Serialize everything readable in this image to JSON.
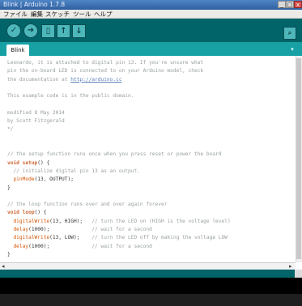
{
  "window": {
    "title": "Blink | Arduino 1.7.8",
    "minimize": "_",
    "maximize": "□",
    "close": "x"
  },
  "menu": [
    "ファイル",
    "編集",
    "スケッチ",
    "ツール",
    "ヘルプ"
  ],
  "toolbar": {
    "verify_icon": "check-icon",
    "upload_icon": "arrow-right-icon",
    "new_icon": "new-file-icon",
    "open_icon": "open-icon",
    "save_icon": "save-icon",
    "serial_icon": "serial-monitor-icon"
  },
  "tabs": [
    {
      "label": "Blink"
    }
  ],
  "tab_menu_icon": "chevron-down-icon",
  "editor": {
    "lines": [
      [
        {
          "t": "Leonardo, it is attached to digital pin 13. If you're unsure what",
          "c": "cmt"
        }
      ],
      [
        {
          "t": "pin the on-board LED is connected to on your Arduino model, check",
          "c": "cmt"
        }
      ],
      [
        {
          "t": "the documentation at ",
          "c": "cmt"
        },
        {
          "t": "http://arduino.cc",
          "c": "link"
        }
      ],
      [
        {
          "t": "",
          "c": "cmt"
        }
      ],
      [
        {
          "t": "This example code is in the public domain.",
          "c": "cmt"
        }
      ],
      [
        {
          "t": "",
          "c": "cmt"
        }
      ],
      [
        {
          "t": "modified 8 May 2014",
          "c": "cmt"
        }
      ],
      [
        {
          "t": "by Scott Fitzgerald",
          "c": "cmt"
        }
      ],
      [
        {
          "t": "*/",
          "c": "cmt"
        }
      ],
      [
        {
          "t": "",
          "c": "plain"
        }
      ],
      [
        {
          "t": "",
          "c": "plain"
        }
      ],
      [
        {
          "t": "// the setup function runs once when you press reset or power the board",
          "c": "cmt"
        }
      ],
      [
        {
          "t": "void ",
          "c": "kw"
        },
        {
          "t": "setup",
          "c": "kw"
        },
        {
          "t": "() {",
          "c": "plain"
        }
      ],
      [
        {
          "t": "  // initialize digital pin 13 as an output.",
          "c": "cmt"
        }
      ],
      [
        {
          "t": "  ",
          "c": "plain"
        },
        {
          "t": "pinMode",
          "c": "fn"
        },
        {
          "t": "(13, OUTPUT);",
          "c": "plain"
        }
      ],
      [
        {
          "t": "}",
          "c": "plain"
        }
      ],
      [
        {
          "t": "",
          "c": "plain"
        }
      ],
      [
        {
          "t": "// the loop function runs over and over again forever",
          "c": "cmt"
        }
      ],
      [
        {
          "t": "void ",
          "c": "kw"
        },
        {
          "t": "loop",
          "c": "kw"
        },
        {
          "t": "() {",
          "c": "plain"
        }
      ],
      [
        {
          "t": "  ",
          "c": "plain"
        },
        {
          "t": "digitalWrite",
          "c": "fn"
        },
        {
          "t": "(13, HIGH);   ",
          "c": "plain"
        },
        {
          "t": "// turn the LED on (HIGH is the voltage level)",
          "c": "cmt"
        }
      ],
      [
        {
          "t": "  ",
          "c": "plain"
        },
        {
          "t": "delay",
          "c": "fn"
        },
        {
          "t": "(1000);              ",
          "c": "plain"
        },
        {
          "t": "// wait for a second",
          "c": "cmt"
        }
      ],
      [
        {
          "t": "  ",
          "c": "plain"
        },
        {
          "t": "digitalWrite",
          "c": "fn"
        },
        {
          "t": "(13, LOW);    ",
          "c": "plain"
        },
        {
          "t": "// turn the LED off by making the voltage LOW",
          "c": "cmt"
        }
      ],
      [
        {
          "t": "  ",
          "c": "plain"
        },
        {
          "t": "delay",
          "c": "fn"
        },
        {
          "t": "(1000);              ",
          "c": "plain"
        },
        {
          "t": "// wait for a second",
          "c": "cmt"
        }
      ],
      [
        {
          "t": "}",
          "c": "plain"
        }
      ]
    ]
  },
  "hscroll": {
    "left": "◂",
    "right": "▸"
  },
  "colors": {
    "toolbar": "#006468",
    "tabstrip": "#17a1a5",
    "button": "#4db7bb",
    "console": "#000000"
  }
}
